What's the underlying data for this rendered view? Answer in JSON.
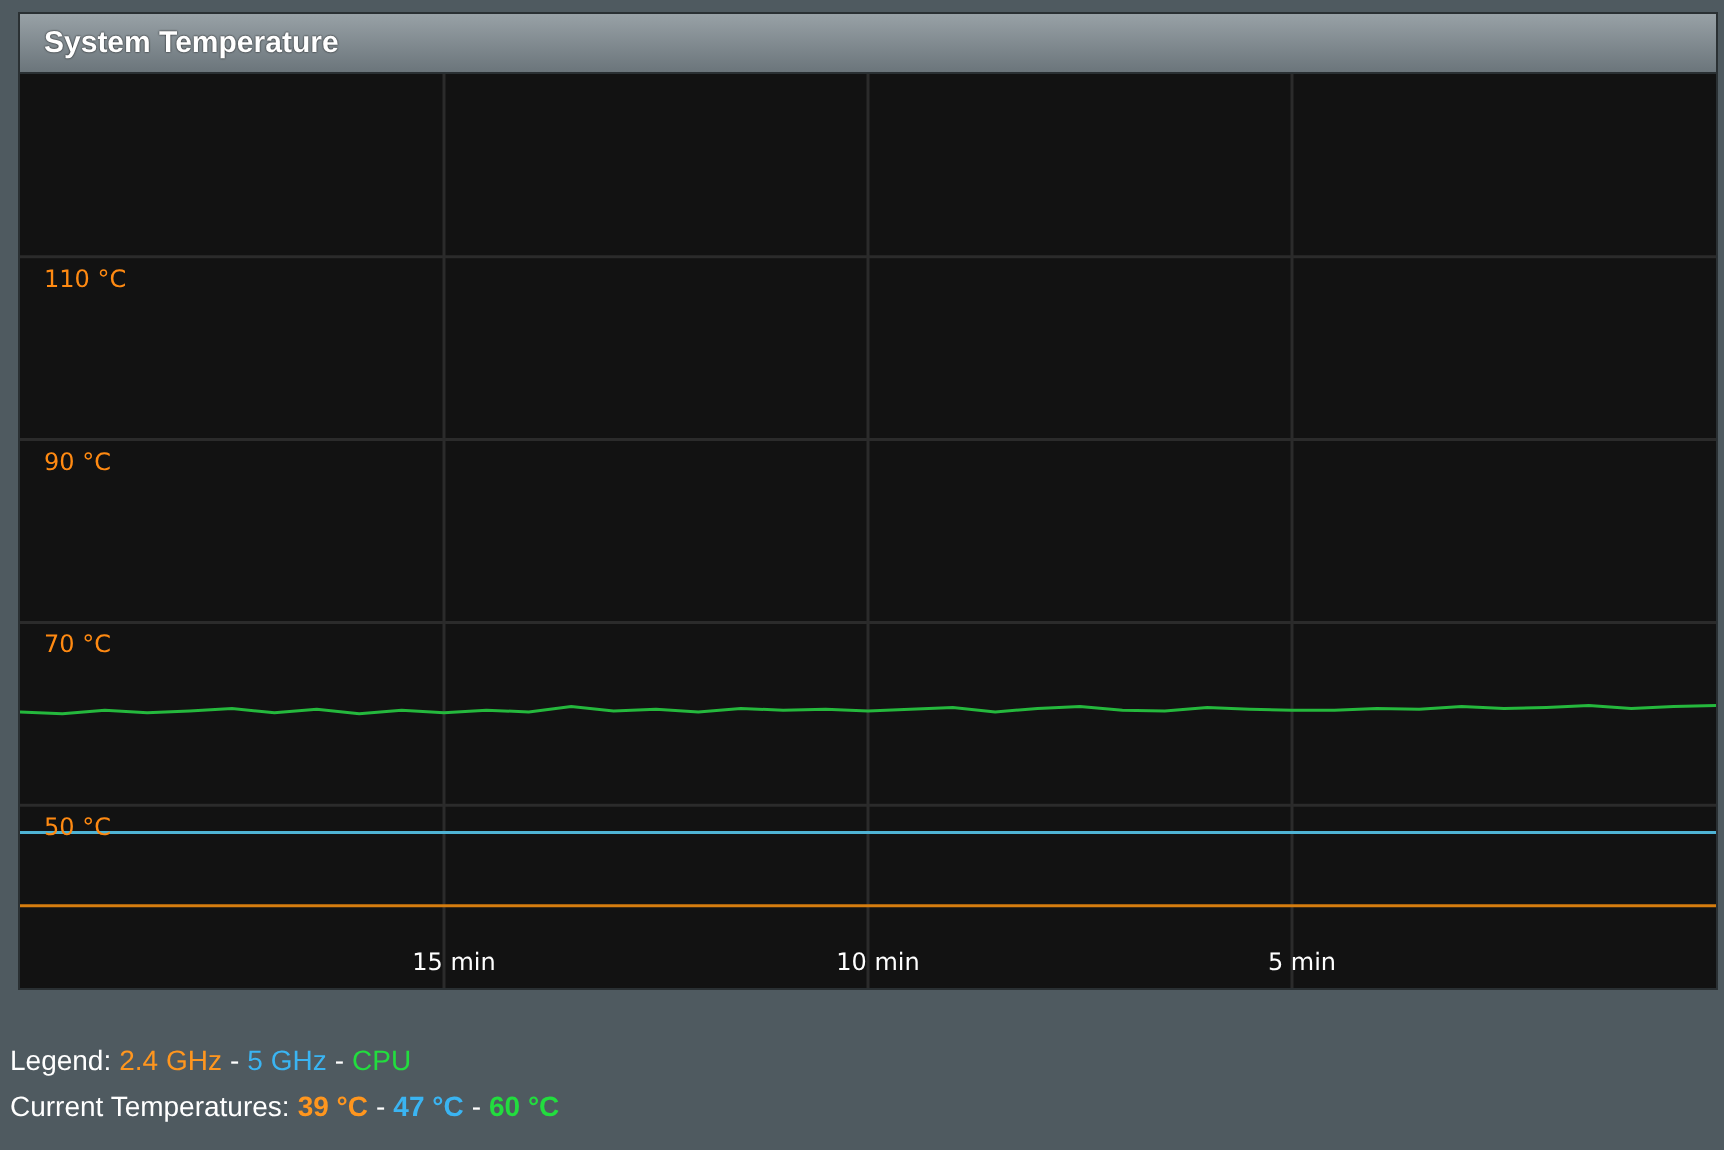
{
  "panel": {
    "title": "System Temperature",
    "chart_data": {
      "type": "line",
      "x": [
        20,
        19.5,
        19,
        18.5,
        18,
        17.5,
        17,
        16.5,
        16,
        15.5,
        15,
        14.5,
        14,
        13.5,
        13,
        12.5,
        12,
        11.5,
        11,
        10.5,
        10,
        9.5,
        9,
        8.5,
        8,
        7.5,
        7,
        6.5,
        6,
        5.5,
        5,
        4.5,
        4,
        3.5,
        3,
        2.5,
        2,
        1.5,
        1,
        0.5,
        0
      ],
      "xlim": [
        20,
        0
      ],
      "ylim": [
        30,
        130
      ],
      "grid": true,
      "xticks": [
        {
          "value": 15,
          "label": "15 min"
        },
        {
          "value": 10,
          "label": "10 min"
        },
        {
          "value": 5,
          "label": "5 min"
        }
      ],
      "yticks": [
        {
          "value": 50,
          "label": "50 °C"
        },
        {
          "value": 70,
          "label": "70 °C"
        },
        {
          "value": 90,
          "label": "90 °C"
        },
        {
          "value": 110,
          "label": "110 °C"
        }
      ],
      "series": [
        {
          "name": "2.4 GHz",
          "color": "#d67d0f",
          "values": [
            39,
            39,
            39,
            39,
            39,
            39,
            39,
            39,
            39,
            39,
            39,
            39,
            39,
            39,
            39,
            39,
            39,
            39,
            39,
            39,
            39,
            39,
            39,
            39,
            39,
            39,
            39,
            39,
            39,
            39,
            39,
            39,
            39,
            39,
            39,
            39,
            39,
            39,
            39,
            39,
            39
          ]
        },
        {
          "name": "5 GHz",
          "color": "#4fb3d4",
          "values": [
            47,
            47,
            47,
            47,
            47,
            47,
            47,
            47,
            47,
            47,
            47,
            47,
            47,
            47,
            47,
            47,
            47,
            47,
            47,
            47,
            47,
            47,
            47,
            47,
            47,
            47,
            47,
            47,
            47,
            47,
            47,
            47,
            47,
            47,
            47,
            47,
            47,
            47,
            47,
            47,
            47
          ]
        },
        {
          "name": "CPU",
          "color": "#25b83d",
          "values": [
            60.2,
            60.0,
            60.4,
            60.1,
            60.3,
            60.6,
            60.1,
            60.5,
            60.0,
            60.4,
            60.1,
            60.4,
            60.2,
            60.8,
            60.3,
            60.5,
            60.2,
            60.6,
            60.4,
            60.5,
            60.3,
            60.5,
            60.7,
            60.2,
            60.6,
            60.8,
            60.4,
            60.3,
            60.7,
            60.5,
            60.4,
            60.4,
            60.6,
            60.5,
            60.8,
            60.6,
            60.7,
            60.9,
            60.6,
            60.8,
            60.9
          ]
        }
      ]
    }
  },
  "legend": {
    "label": "Legend:",
    "items": [
      {
        "color": "#ff961e"
      },
      {
        "color": "#3ab4f2"
      },
      {
        "color": "#22dd3e"
      }
    ],
    "separators": [
      "-",
      "-"
    ]
  },
  "current": {
    "label": "Current Temperatures:",
    "items": [
      {
        "text": "39 °C",
        "color": "#ff961e"
      },
      {
        "text": "47 °C",
        "color": "#3ab4f2"
      },
      {
        "text": "60 °C",
        "color": "#22dd3e"
      }
    ],
    "separators": [
      "-",
      "-"
    ]
  }
}
